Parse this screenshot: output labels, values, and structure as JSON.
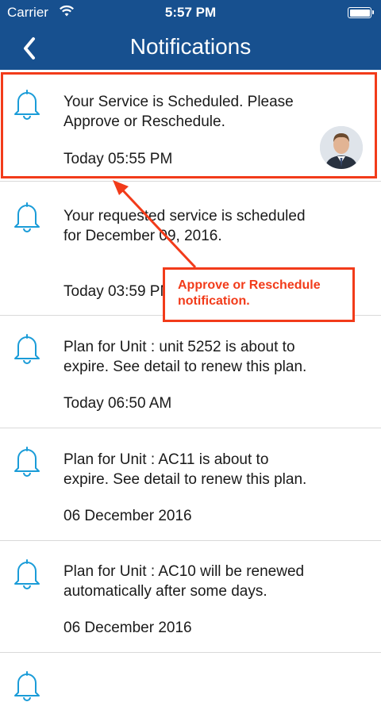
{
  "status_bar": {
    "carrier": "Carrier",
    "time": "5:57 PM"
  },
  "nav": {
    "title": "Notifications"
  },
  "notifications": [
    {
      "message": "Your Service is Scheduled. Please Approve or Reschedule.",
      "timestamp": "Today 05:55 PM"
    },
    {
      "message": "Your requested service is scheduled for December 09, 2016.",
      "timestamp": "Today 03:59 PM"
    },
    {
      "message": "Plan for Unit : unit 5252 is about to expire. See detail to renew this plan.",
      "timestamp": "Today 06:50 AM"
    },
    {
      "message": "Plan for Unit : AC11 is about to expire. See detail to renew this plan.",
      "timestamp": "06 December 2016"
    },
    {
      "message": "Plan for Unit : AC10 will be renewed automatically after some days.",
      "timestamp": "06 December 2016"
    }
  ],
  "annotation": {
    "line1": "Approve or Reschedule",
    "line2": "notification.",
    "color": "#f23b1a"
  },
  "colors": {
    "header": "#17508f",
    "bell_icon": "#1a9cd8"
  }
}
